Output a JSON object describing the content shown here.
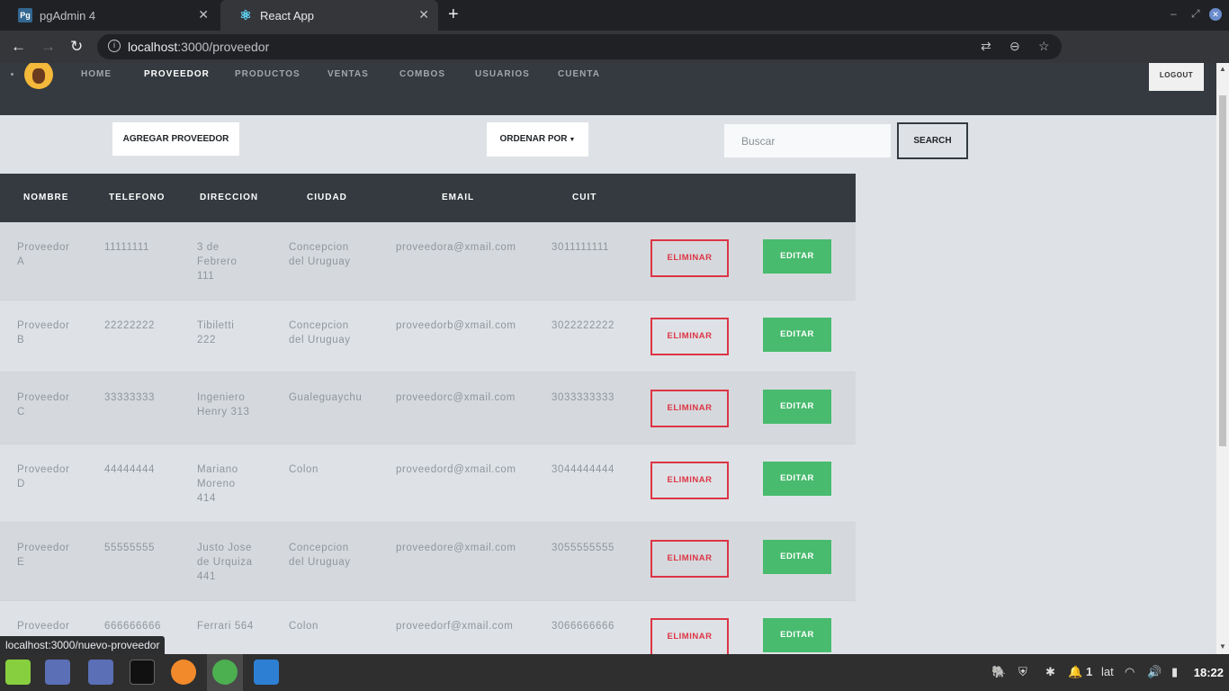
{
  "browser": {
    "tabs": [
      {
        "title": "pgAdmin 4",
        "icon": "pgadmin-icon"
      },
      {
        "title": "React App",
        "icon": "react-icon"
      }
    ],
    "url_host": "localhost",
    "url_rest": ":3000/proveedor",
    "status_url": "localhost:3000/nuevo-proveedor"
  },
  "nav": {
    "items": [
      "HOME",
      "PROVEEDOR",
      "PRODUCTOS",
      "VENTAS",
      "COMBOS",
      "USUARIOS",
      "CUENTA"
    ],
    "active": "PROVEEDOR",
    "logout": "LOGOUT"
  },
  "toolbar": {
    "add_label": "AGREGAR PROVEEDOR",
    "order_label": "ORDENAR POR",
    "search_placeholder": "Buscar",
    "search_label": "SEARCH"
  },
  "table": {
    "headers": [
      "NOMBRE",
      "TELEFONO",
      "DIRECCION",
      "CIUDAD",
      "EMAIL",
      "CUIT"
    ],
    "delete_label": "ELIMINAR",
    "edit_label": "EDITAR",
    "rows": [
      {
        "nombre": [
          "Proveedor",
          "A"
        ],
        "telefono": "11111111",
        "direccion": [
          "3 de",
          "Febrero",
          "111"
        ],
        "ciudad": [
          "Concepcion",
          "del Uruguay"
        ],
        "email": "proveedora@xmail.com",
        "cuit": "3011111111"
      },
      {
        "nombre": [
          "Proveedor",
          "B"
        ],
        "telefono": "22222222",
        "direccion": [
          "Tibiletti",
          "222"
        ],
        "ciudad": [
          "Concepcion",
          "del Uruguay"
        ],
        "email": "proveedorb@xmail.com",
        "cuit": "3022222222"
      },
      {
        "nombre": [
          "Proveedor",
          "C"
        ],
        "telefono": "33333333",
        "direccion": [
          "Ingeniero",
          "Henry 313"
        ],
        "ciudad": [
          "Gualeguaychu"
        ],
        "email": "proveedorc@xmail.com",
        "cuit": "3033333333"
      },
      {
        "nombre": [
          "Proveedor",
          "D"
        ],
        "telefono": "44444444",
        "direccion": [
          "Mariano",
          "Moreno",
          "414"
        ],
        "ciudad": [
          "Colon"
        ],
        "email": "proveedord@xmail.com",
        "cuit": "3044444444"
      },
      {
        "nombre": [
          "Proveedor",
          "E"
        ],
        "telefono": "55555555",
        "direccion": [
          "Justo Jose",
          "de Urquiza",
          "441"
        ],
        "ciudad": [
          "Concepcion",
          "del Uruguay"
        ],
        "email": "proveedore@xmail.com",
        "cuit": "3055555555"
      },
      {
        "nombre": [
          "Proveedor"
        ],
        "telefono": "666666666",
        "direccion": [
          "Ferrari 564"
        ],
        "ciudad": [
          "Colon"
        ],
        "email": "proveedorf@xmail.com",
        "cuit": "3066666666"
      }
    ]
  },
  "taskbar": {
    "tray_workspace": "1",
    "tray_lang": "lat",
    "clock": "18:22"
  }
}
